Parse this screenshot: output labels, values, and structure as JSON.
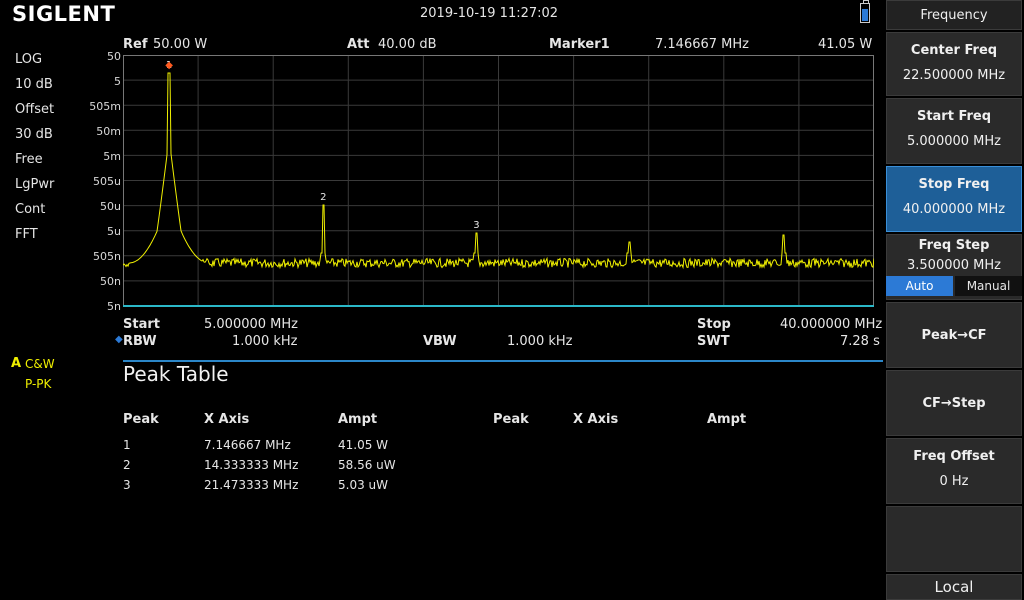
{
  "brand": "SIGLENT",
  "datetime": "2019-10-19   11:27:02",
  "left_panel": [
    "LOG",
    "10 dB",
    "Offset",
    "30 dB",
    "Free",
    "LgPwr",
    "Cont",
    "FFT"
  ],
  "trace_label": {
    "letter": "A",
    "mode": "C&W",
    "detector": "P-PK"
  },
  "header": {
    "ref_label": "Ref",
    "ref_value": "50.00 W",
    "att_label": "Att",
    "att_value": "40.00 dB",
    "marker_label": "Marker1",
    "marker_freq": "7.146667 MHz",
    "marker_ampt": "41.05 W"
  },
  "y_axis_labels": [
    "50",
    "5",
    "505m",
    "50m",
    "5m",
    "505u",
    "50u",
    "5u",
    "505n",
    "50n",
    "5n"
  ],
  "footer": {
    "start_label": "Start",
    "start_value": "5.000000 MHz",
    "stop_label": "Stop",
    "stop_value": "40.000000 MHz",
    "rbw_label": "RBW",
    "rbw_value": "1.000 kHz",
    "vbw_label": "VBW",
    "vbw_value": "1.000 kHz",
    "swt_label": "SWT",
    "swt_value": "7.28 s"
  },
  "peak_table": {
    "title": "Peak Table",
    "headers": [
      "Peak",
      "X Axis",
      "Ampt",
      "Peak",
      "X Axis",
      "Ampt"
    ],
    "rows": [
      [
        "1",
        "7.146667 MHz",
        "41.05 W"
      ],
      [
        "2",
        "14.333333 MHz",
        "58.56 uW"
      ],
      [
        "3",
        "21.473333 MHz",
        "5.03 uW"
      ]
    ]
  },
  "softkeys": {
    "menu_title": "Frequency",
    "center_freq": {
      "label": "Center Freq",
      "value": "22.500000 MHz"
    },
    "start_freq": {
      "label": "Start Freq",
      "value": "5.000000 MHz"
    },
    "stop_freq": {
      "label": "Stop Freq",
      "value": "40.000000 MHz"
    },
    "freq_step": {
      "label": "Freq Step",
      "value": "3.500000 MHz",
      "auto": "Auto",
      "manual": "Manual"
    },
    "peak_cf": "Peak→CF",
    "cf_step": "CF→Step",
    "freq_offset": {
      "label": "Freq Offset",
      "value": "0 Hz"
    },
    "local": "Local"
  },
  "markers": [
    {
      "label": "1",
      "freq_mhz": 7.146667
    },
    {
      "label": "2",
      "freq_mhz": 14.333333
    },
    {
      "label": "3",
      "freq_mhz": 21.473333
    }
  ],
  "colors": {
    "trace": "#f0f000",
    "accent": "#2c7ad6",
    "grid": "#3a3a3a"
  }
}
